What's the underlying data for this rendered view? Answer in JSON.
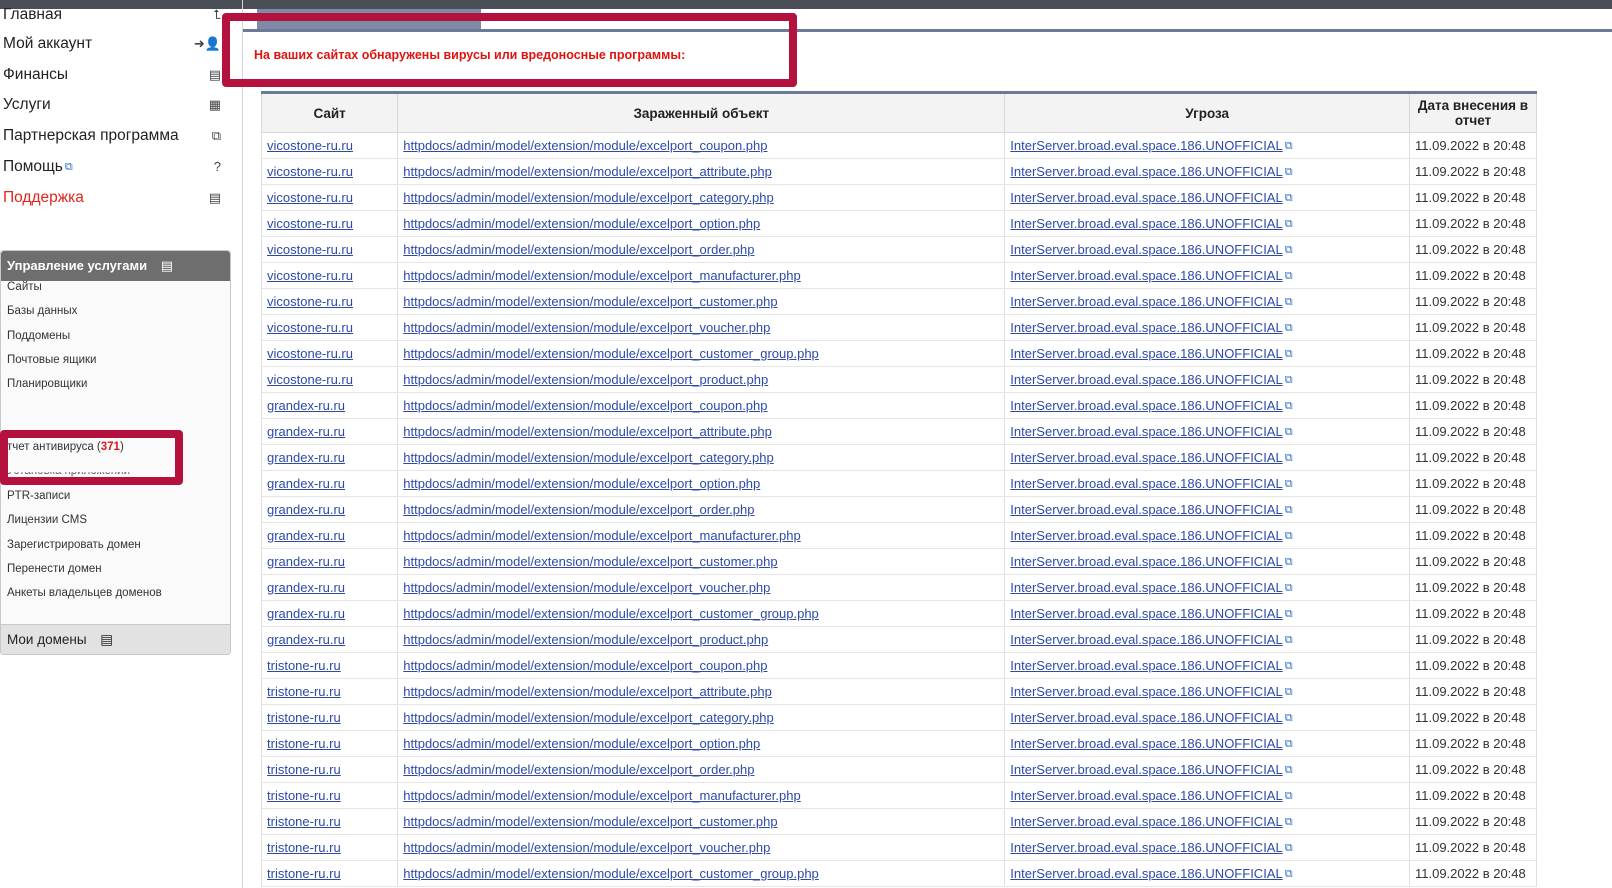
{
  "main_nav": [
    {
      "label": "Главная",
      "icon": "home-icon",
      "glyph": "⮤"
    },
    {
      "label": "Мой аккаунт",
      "icon": "add-user-icon",
      "glyph": "➜👤"
    },
    {
      "label": "Финансы",
      "icon": "finance-icon",
      "glyph": "▤"
    },
    {
      "label": "Услуги",
      "icon": "services-icon",
      "glyph": "▦"
    },
    {
      "label": "Партнерская программа",
      "icon": "partner-icon",
      "glyph": "⧉"
    },
    {
      "label": "Помощь",
      "icon": "help-icon",
      "glyph": "?",
      "external": true
    },
    {
      "label": "Поддержка",
      "icon": "support-icon",
      "glyph": "▤",
      "accent": "#e1251b"
    }
  ],
  "management": {
    "title": "Управление услугами",
    "items": [
      "Сайты",
      "Базы данных",
      "Поддомены",
      "Почтовые ящики",
      "Планировщики"
    ],
    "antivirus_label": "тчет антивируса (",
    "antivirus_count": "371",
    "antivirus_close": ")",
    "partial_item": "Установка приложений",
    "items_after": [
      "PTR-записи",
      "Лицензии CMS",
      "Зарегистрировать домен",
      "Перенести домен",
      "Анкеты владельцев доменов"
    ],
    "my_domains": "Мои домены"
  },
  "alert": "На ваших сайтах обнаружены вирусы или вредоносные программы:",
  "table": {
    "headers": [
      "Сайт",
      "Зараженный объект",
      "Угроза",
      "Дата внесения в отчет"
    ],
    "threat": "InterServer.broad.eval.space.186.UNOFFICIAL",
    "date": "11.09.2022 в 20:48",
    "rows": [
      {
        "site": "vicostone-ru.ru",
        "object": "httpdocs/admin/model/extension/module/excelport_coupon.php"
      },
      {
        "site": "vicostone-ru.ru",
        "object": "httpdocs/admin/model/extension/module/excelport_attribute.php"
      },
      {
        "site": "vicostone-ru.ru",
        "object": "httpdocs/admin/model/extension/module/excelport_category.php"
      },
      {
        "site": "vicostone-ru.ru",
        "object": "httpdocs/admin/model/extension/module/excelport_option.php"
      },
      {
        "site": "vicostone-ru.ru",
        "object": "httpdocs/admin/model/extension/module/excelport_order.php"
      },
      {
        "site": "vicostone-ru.ru",
        "object": "httpdocs/admin/model/extension/module/excelport_manufacturer.php"
      },
      {
        "site": "vicostone-ru.ru",
        "object": "httpdocs/admin/model/extension/module/excelport_customer.php"
      },
      {
        "site": "vicostone-ru.ru",
        "object": "httpdocs/admin/model/extension/module/excelport_voucher.php"
      },
      {
        "site": "vicostone-ru.ru",
        "object": "httpdocs/admin/model/extension/module/excelport_customer_group.php"
      },
      {
        "site": "vicostone-ru.ru",
        "object": "httpdocs/admin/model/extension/module/excelport_product.php"
      },
      {
        "site": "grandex-ru.ru",
        "object": "httpdocs/admin/model/extension/module/excelport_coupon.php"
      },
      {
        "site": "grandex-ru.ru",
        "object": "httpdocs/admin/model/extension/module/excelport_attribute.php"
      },
      {
        "site": "grandex-ru.ru",
        "object": "httpdocs/admin/model/extension/module/excelport_category.php"
      },
      {
        "site": "grandex-ru.ru",
        "object": "httpdocs/admin/model/extension/module/excelport_option.php"
      },
      {
        "site": "grandex-ru.ru",
        "object": "httpdocs/admin/model/extension/module/excelport_order.php"
      },
      {
        "site": "grandex-ru.ru",
        "object": "httpdocs/admin/model/extension/module/excelport_manufacturer.php"
      },
      {
        "site": "grandex-ru.ru",
        "object": "httpdocs/admin/model/extension/module/excelport_customer.php"
      },
      {
        "site": "grandex-ru.ru",
        "object": "httpdocs/admin/model/extension/module/excelport_voucher.php"
      },
      {
        "site": "grandex-ru.ru",
        "object": "httpdocs/admin/model/extension/module/excelport_customer_group.php"
      },
      {
        "site": "grandex-ru.ru",
        "object": "httpdocs/admin/model/extension/module/excelport_product.php"
      },
      {
        "site": "tristone-ru.ru",
        "object": "httpdocs/admin/model/extension/module/excelport_coupon.php"
      },
      {
        "site": "tristone-ru.ru",
        "object": "httpdocs/admin/model/extension/module/excelport_attribute.php"
      },
      {
        "site": "tristone-ru.ru",
        "object": "httpdocs/admin/model/extension/module/excelport_category.php"
      },
      {
        "site": "tristone-ru.ru",
        "object": "httpdocs/admin/model/extension/module/excelport_option.php"
      },
      {
        "site": "tristone-ru.ru",
        "object": "httpdocs/admin/model/extension/module/excelport_order.php"
      },
      {
        "site": "tristone-ru.ru",
        "object": "httpdocs/admin/model/extension/module/excelport_manufacturer.php"
      },
      {
        "site": "tristone-ru.ru",
        "object": "httpdocs/admin/model/extension/module/excelport_customer.php"
      },
      {
        "site": "tristone-ru.ru",
        "object": "httpdocs/admin/model/extension/module/excelport_voucher.php"
      },
      {
        "site": "tristone-ru.ru",
        "object": "httpdocs/admin/model/extension/module/excelport_customer_group.php"
      }
    ]
  },
  "colors": {
    "accent_red": "#e0140f",
    "highlight": "#b4113f",
    "link": "#2e4aa8",
    "header_bar": "#6b7a99"
  }
}
